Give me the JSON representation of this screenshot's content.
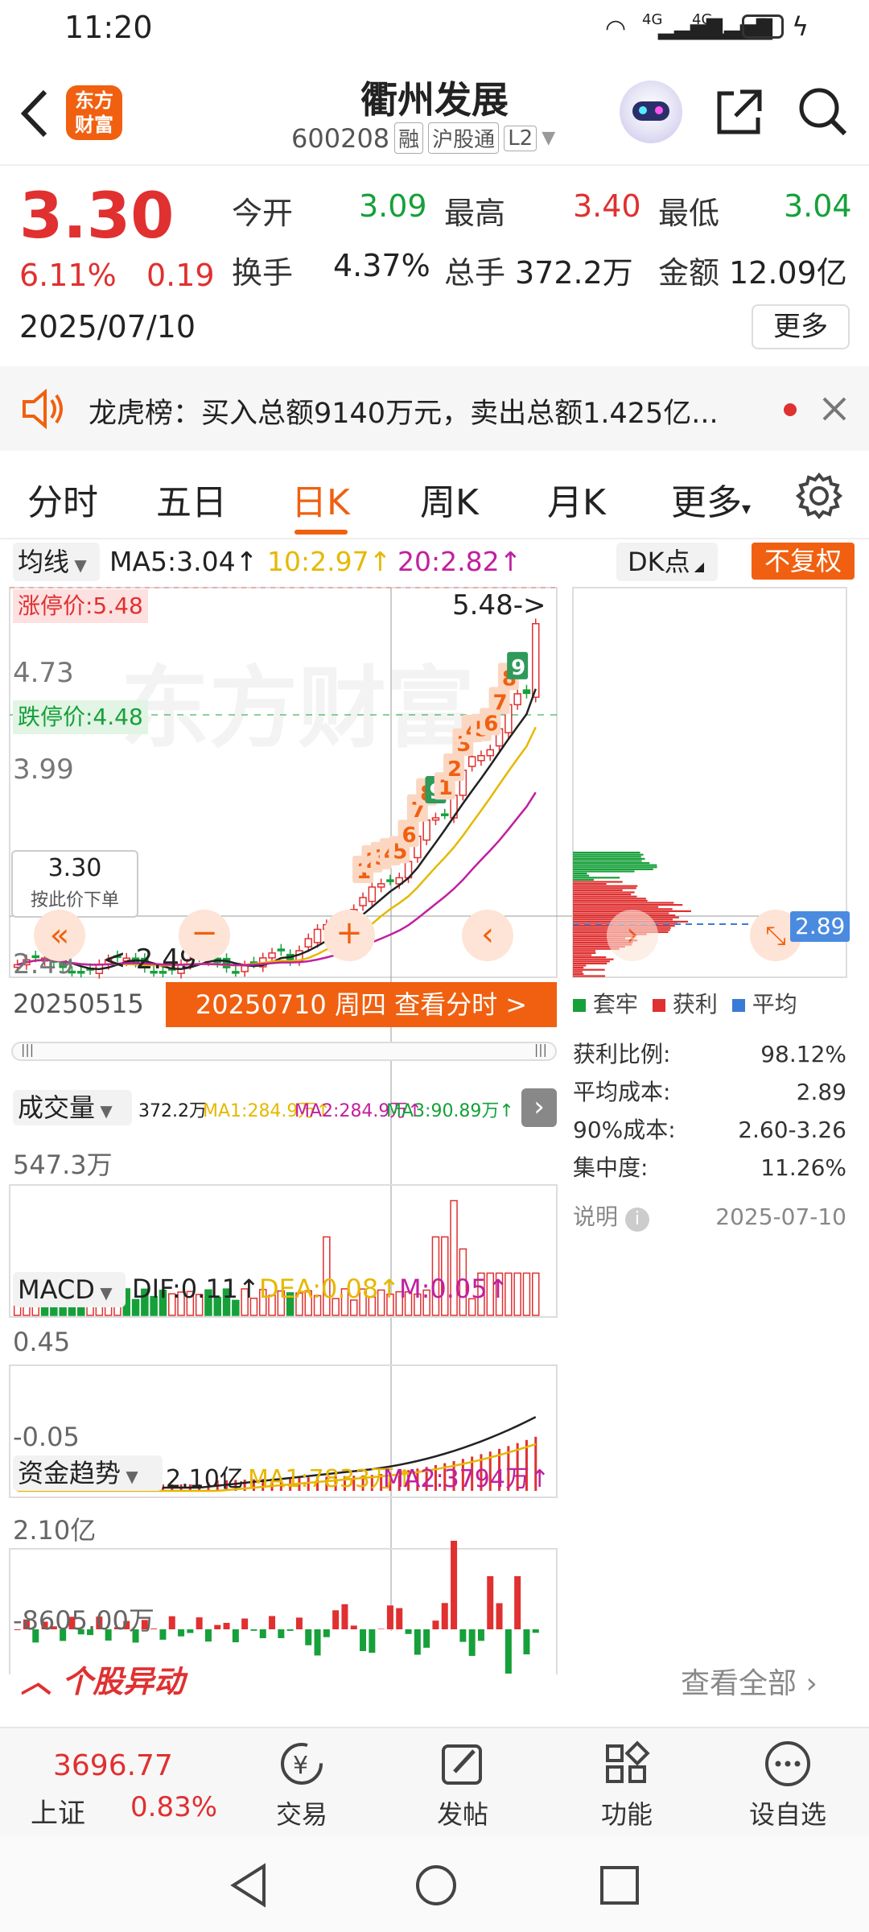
{
  "status_bar": {
    "time": "11:20",
    "signal1": "4G",
    "signal2": "4G",
    "battery": "5"
  },
  "header": {
    "logo_line1": "东方",
    "logo_line2": "财富",
    "stock_name": "衢州发展",
    "stock_code": "600208",
    "tags": [
      "融",
      "沪股通",
      "L2"
    ]
  },
  "quote": {
    "price": "3.30",
    "change_pct": "6.11%",
    "change": "0.19",
    "date": "2025/07/10",
    "open_label": "今开",
    "open": "3.09",
    "high_label": "最高",
    "high": "3.40",
    "low_label": "最低",
    "low": "3.04",
    "turnover_label": "换手",
    "turnover": "4.37%",
    "volume_label": "总手",
    "volume": "372.2万",
    "amount_label": "金额",
    "amount": "12.09亿",
    "more_label": "更多"
  },
  "notice": {
    "text": "龙虎榜：买入总额9140万元，卖出总额1.425亿..."
  },
  "tabs": {
    "items": [
      "分时",
      "五日",
      "日K",
      "周K",
      "月K",
      "更多"
    ],
    "active": 2
  },
  "kline": {
    "ma_selector": "均线",
    "ma5": "MA5:3.04↑",
    "ma10": "10:2.97↑",
    "ma20": "20:2.82↑",
    "dk_label": "DK点",
    "fuquan_label": "不复权",
    "limit_up": "涨停价:5.48",
    "limit_down": "跌停价:4.48",
    "y_ticks": [
      "4.73",
      "3.99"
    ],
    "low_label": "2.49",
    "high_arrow": "5.48->",
    "low_arrow": "<-2.49",
    "cursor_price": "3.30",
    "cursor_hint": "按此价下单",
    "start_date": "20250515",
    "cursor_banner": "20250710 周四  查看分时 >",
    "td_marks": [
      "1",
      "2",
      "3",
      "4",
      "5",
      "6",
      "7",
      "8",
      "9",
      "1",
      "2",
      "3",
      "4",
      "5",
      "6",
      "7",
      "8",
      "9"
    ]
  },
  "chips": {
    "avg_price": "2.89",
    "legend": [
      "套牢",
      "获利",
      "平均"
    ],
    "profit_ratio_label": "获利比例:",
    "profit_ratio": "98.12%",
    "avg_cost_label": "平均成本:",
    "avg_cost": "2.89",
    "cost90_label": "90%成本:",
    "cost90": "2.60-3.26",
    "concentration_label": "集中度:",
    "concentration": "11.26%",
    "note_label": "说明",
    "note_date": "2025-07-10"
  },
  "volume": {
    "selector": "成交量",
    "value": "372.2万",
    "ma1": "MA1:284.9万↑",
    "ma2": "MA2:284.9万↑",
    "ma3": "MA3:90.89万↑",
    "max_label": "547.3万"
  },
  "macd": {
    "selector": "MACD",
    "dif": "DIF:0.11↑",
    "dea": "DEA:0.08↑",
    "m": "M:0.05↑",
    "top_label": "0.45",
    "bottom_label": "-0.05"
  },
  "fund": {
    "selector": "资金趋势",
    "value": "2.10亿",
    "ma1": "MA1:7833万↑",
    "ma2": "MA2:3794万↑",
    "top_label": "2.10亿",
    "bottom_label": "-8605.00万"
  },
  "yidong": {
    "title": "个股异动",
    "link": "查看全部"
  },
  "bottom_nav": {
    "index_value": "3696.77",
    "index_name": "上证",
    "index_change": "0.83%",
    "items": [
      "交易",
      "发帖",
      "功能",
      "设自选"
    ]
  },
  "colors": {
    "red": "#e03030",
    "green": "#16a03a",
    "orange": "#f06010",
    "ma10": "#e6b800",
    "ma20": "#c020a0"
  }
}
